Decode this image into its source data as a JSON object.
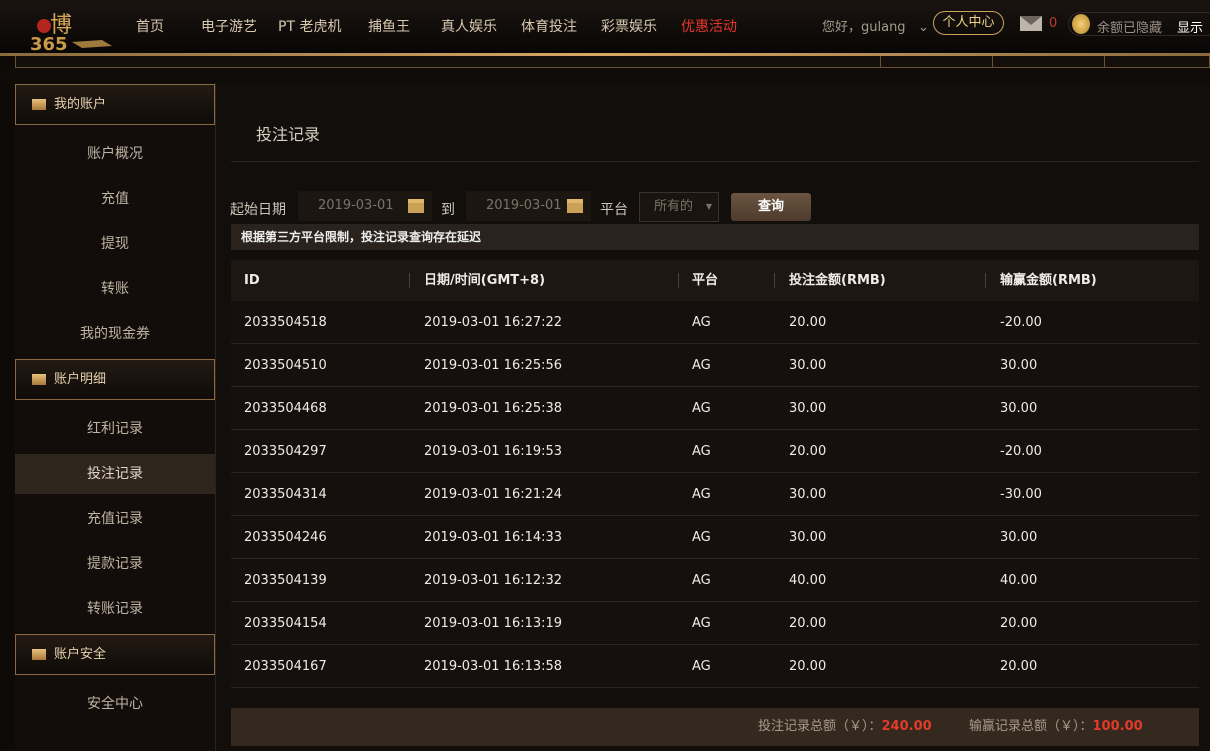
{
  "header": {
    "logo_text": "博365",
    "nav": [
      "首页",
      "电子游艺",
      "PT 老虎机",
      "捕鱼王",
      "真人娱乐",
      "体育投注",
      "彩票娱乐",
      "优惠活动"
    ],
    "greeting": "您好，gulang",
    "personal_center": "个人中心",
    "mail_count": "0",
    "balance_hidden": "余额已隐藏",
    "show": "显示"
  },
  "sidebar": {
    "sections": [
      {
        "label": "我的账户",
        "items": [
          "账户概况",
          "充值",
          "提现",
          "转账",
          "我的现金券"
        ]
      },
      {
        "label": "账户明细",
        "items": [
          "红利记录",
          "投注记录",
          "充值记录",
          "提款记录",
          "转账记录"
        ]
      },
      {
        "label": "账户安全",
        "items": [
          "安全中心"
        ]
      }
    ],
    "active": "投注记录"
  },
  "main": {
    "title": "投注记录",
    "filter": {
      "start_label": "起始日期",
      "start_date": "2019-03-01",
      "to_label": "到",
      "end_date": "2019-03-01",
      "platform_label": "平台",
      "platform_value": "所有的",
      "query_button": "查询"
    },
    "notice": "根据第三方平台限制，投注记录查询存在延迟",
    "columns": [
      "ID",
      "日期/时间(GMT+8)",
      "平台",
      "投注金额(RMB)",
      "输赢金额(RMB)"
    ],
    "rows": [
      [
        "2033504518",
        "2019-03-01 16:27:22",
        "AG",
        "20.00",
        "-20.00"
      ],
      [
        "2033504510",
        "2019-03-01 16:25:56",
        "AG",
        "30.00",
        "30.00"
      ],
      [
        "2033504468",
        "2019-03-01 16:25:38",
        "AG",
        "30.00",
        "30.00"
      ],
      [
        "2033504297",
        "2019-03-01 16:19:53",
        "AG",
        "20.00",
        "-20.00"
      ],
      [
        "2033504314",
        "2019-03-01 16:21:24",
        "AG",
        "30.00",
        "-30.00"
      ],
      [
        "2033504246",
        "2019-03-01 16:14:33",
        "AG",
        "30.00",
        "30.00"
      ],
      [
        "2033504139",
        "2019-03-01 16:12:32",
        "AG",
        "40.00",
        "40.00"
      ],
      [
        "2033504154",
        "2019-03-01 16:13:19",
        "AG",
        "20.00",
        "20.00"
      ],
      [
        "2033504167",
        "2019-03-01 16:13:58",
        "AG",
        "20.00",
        "20.00"
      ]
    ],
    "footer": {
      "bet_total_label": "投注记录总额（￥）：",
      "bet_total": "240.00",
      "win_total_label": "输赢记录总额（￥）：",
      "win_total": "100.00"
    }
  }
}
